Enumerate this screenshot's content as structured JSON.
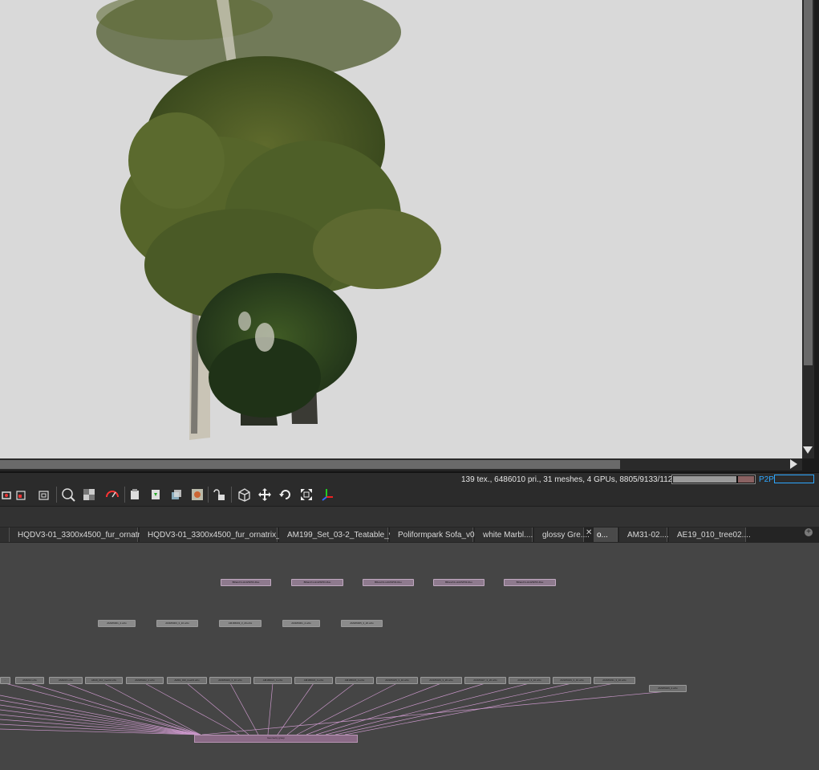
{
  "viewport": {
    "status_text": "139 tex., 6486010 pri., 31 meshes, 4 GPUs, 8805/9133/11264 MB",
    "memory_used_fraction": 0.78,
    "memory_reserved_fraction": 0.8,
    "p2p_label": "P2P"
  },
  "toolbar": {
    "icons": [
      "camera-icon",
      "region-render-icon",
      "pick-focus-icon",
      "zoom-region-icon",
      "alpha-checker-icon",
      "exposure-icon",
      "copy-to-clipboard-icon",
      "save-render-icon",
      "export-passes-icon",
      "color-picker-icon",
      "lock-icon",
      "bounding-box-icon",
      "move-icon",
      "rotate-icon",
      "fit-icon",
      "gizmo-axis-icon"
    ]
  },
  "tabs": [
    {
      "label": ""
    },
    {
      "label": "HQDV3-01_3300x4500_fur_ornatrix1...."
    },
    {
      "label": "HQDV3-01_3300x4500_fur_ornatrix_rev...."
    },
    {
      "label": "AM199_Set_03-2_Teatable_v2...."
    },
    {
      "label": "Poliformpark Sofa_v0...."
    },
    {
      "label": "white Marbl...."
    },
    {
      "label": "glossy Gre...."
    },
    {
      "label": "o..."
    },
    {
      "label": "AM31-02...."
    },
    {
      "label": "AE19_010_tree02...."
    }
  ],
  "graph": {
    "material_nodes": [
      "BRanch1-Hrd2SP03-Ruu",
      "BRanch1-Hrd2SP03-Ruu",
      "BRanch1-Hrd2SP03-Ruu",
      "BRanch1-Hrd2SP03-Ruu",
      "BRanch1-Hrd2SP03-Ruu"
    ],
    "texture_nodes": [
      "AM186001_4.orbx",
      "AM186003_3_10.orbx",
      "AM186003_3_20.orbx",
      "AM186001_4.orbx",
      "AM186005_3_20.orbx"
    ],
    "mesh_nodes": [
      "...",
      "AM3210.orbx",
      "AM3215.orbx",
      "AM19_010_tree02.orbx",
      "AM186022_4.orbx",
      "AM19_010_tree03.orbx",
      "AM186020_3_10.orbx",
      "AM186021_4.orbx",
      "AM186022_4.orbx",
      "AM186023_4.orbx",
      "AM186025_3_10.orbx",
      "AM186026_3_20.orbx",
      "AM186027_3_20.orbx",
      "AM186028_3_10.orbx",
      "AM186029_3_10.orbx",
      "AM186031_3_10.orbx"
    ],
    "extra_node": "AM186029_4.orbx",
    "group_node": "Geometry group"
  }
}
